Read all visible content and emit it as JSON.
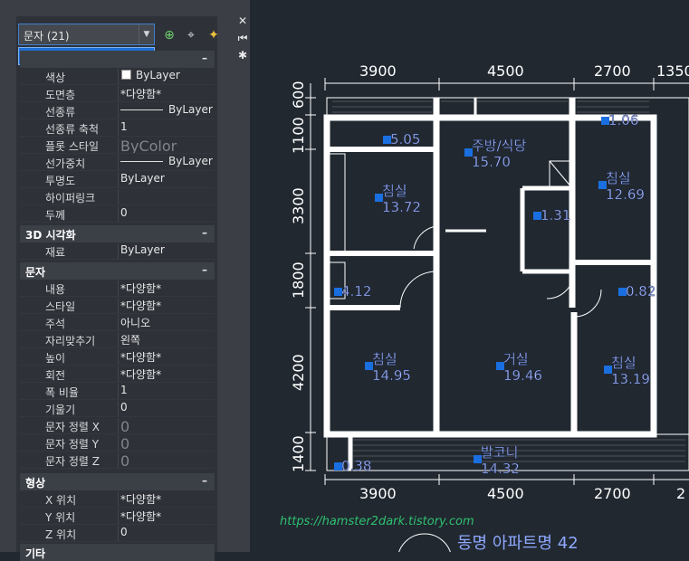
{
  "selector": {
    "value": "문자 (21)",
    "dropdown_option": "문자 (21)"
  },
  "window_controls": {
    "close": "✕",
    "pin": "⏮",
    "options": "✱"
  },
  "general_rows": [
    {
      "label": "색상",
      "value": "ByLayer"
    },
    {
      "label": "도면층",
      "value": "*다양함*"
    },
    {
      "label": "선종류",
      "value": "ByLayer"
    },
    {
      "label": "선종류 축척",
      "value": "1"
    },
    {
      "label": "플롯 스타일",
      "value": "ByColor"
    },
    {
      "label": "선가중치",
      "value": "ByLayer"
    },
    {
      "label": "투명도",
      "value": "ByLayer"
    },
    {
      "label": "하이퍼링크",
      "value": ""
    },
    {
      "label": "두께",
      "value": "0"
    }
  ],
  "section_3d": {
    "title": "3D 시각화",
    "collapse": "–",
    "rows": [
      {
        "label": "재료",
        "value": "ByLayer"
      }
    ]
  },
  "section_text": {
    "title": "문자",
    "collapse": "–",
    "rows": [
      {
        "label": "내용",
        "value": "*다양함*"
      },
      {
        "label": "스타일",
        "value": "*다양함*"
      },
      {
        "label": "주석",
        "value": "아니오"
      },
      {
        "label": "자리맞추기",
        "value": "왼쪽"
      },
      {
        "label": "높이",
        "value": "*다양함*"
      },
      {
        "label": "회전",
        "value": "*다양함*"
      },
      {
        "label": "폭 비율",
        "value": "1"
      },
      {
        "label": "기울기",
        "value": "0"
      },
      {
        "label": "문자 정렬 X",
        "value": "0"
      },
      {
        "label": "문자 정렬 Y",
        "value": "0"
      },
      {
        "label": "문자 정렬 Z",
        "value": "0"
      }
    ]
  },
  "section_geometry": {
    "title": "형상",
    "collapse": "–",
    "rows": [
      {
        "label": "X 위치",
        "value": "*다양함*"
      },
      {
        "label": "Y 위치",
        "value": "*다양함*"
      },
      {
        "label": "Z 위치",
        "value": "0"
      }
    ]
  },
  "section_misc": {
    "title": "기타"
  },
  "drawing": {
    "dims_top": [
      "3900",
      "4500",
      "2700",
      "1350"
    ],
    "dims_bottom": [
      "3900",
      "4500",
      "2700",
      "2"
    ],
    "dims_left": [
      "600",
      "1100",
      "3300",
      "1800",
      "4200",
      "1400"
    ],
    "rooms": [
      {
        "name": "",
        "area": "5.05"
      },
      {
        "name": "주방/식당",
        "area": "15.70"
      },
      {
        "name": "",
        "area": "1.06"
      },
      {
        "name": "침실",
        "area": "13.72"
      },
      {
        "name": "침실",
        "area": "12.69"
      },
      {
        "name": "",
        "area": "1.31"
      },
      {
        "name": "",
        "area": "4.12"
      },
      {
        "name": "",
        "area": "0.82"
      },
      {
        "name": "침실",
        "area": "14.95"
      },
      {
        "name": "거실",
        "area": "19.46"
      },
      {
        "name": "침실",
        "area": "13.19"
      },
      {
        "name": "",
        "area": "0.38"
      },
      {
        "name": "발코니",
        "area": "14.32"
      }
    ],
    "url": "https://hamster2dark.tistory.com",
    "title": "동명 아파트명 42"
  }
}
